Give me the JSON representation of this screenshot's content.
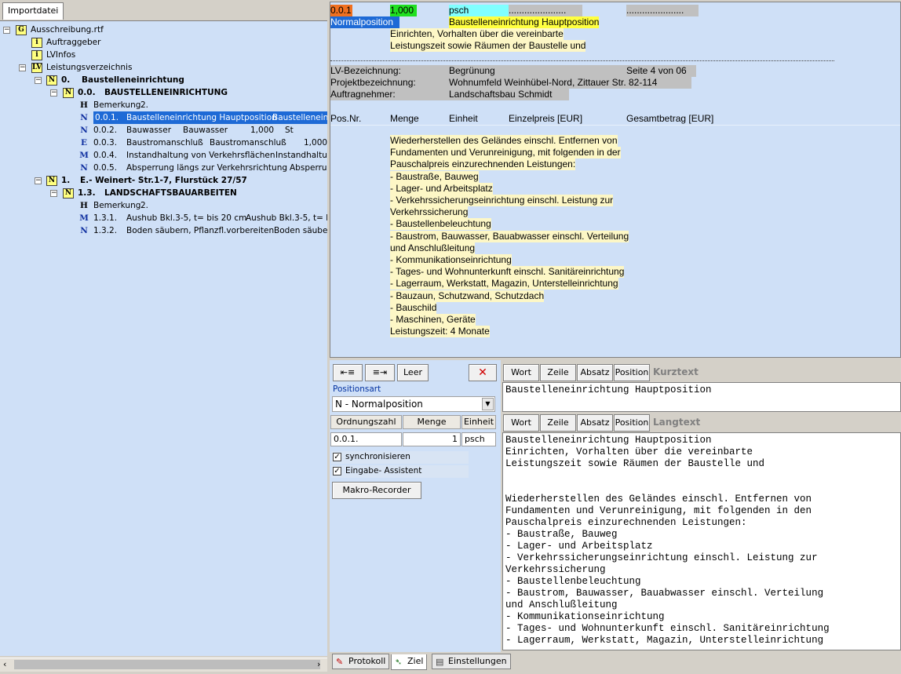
{
  "left_tab": "Importdatei",
  "tree": {
    "root": "Ausschreibung.rtf",
    "auftraggeber": "Auftraggeber",
    "lvinfos": "LVInfos",
    "leistungsverzeichnis": "Leistungsverzeichnis",
    "items": [
      {
        "nr": "0.",
        "text": "Baustelleneinrichtung"
      },
      {
        "nr": "0.0.",
        "text": "BAUSTELLENEINRICHTUNG"
      },
      {
        "nr": "Bemerkung",
        "text": "2."
      },
      {
        "nr": "0.0.1.",
        "text": "Baustelleneinrichtung Hauptposition",
        "extra": "Baustelleneinr"
      },
      {
        "nr": "0.0.2.",
        "text": "Bauwasser",
        "c2": "Bauwasser",
        "c3": "1,000",
        "c4": "St"
      },
      {
        "nr": "0.0.3.",
        "text": "Baustromanschluß",
        "c2": "Baustromanschluß",
        "c3": "1,000"
      },
      {
        "nr": "0.0.4.",
        "text": "Instandhaltung von Verkehrsflächen",
        "c2": "Instandhaltun"
      },
      {
        "nr": "0.0.5.",
        "text": "Absperrung längs zur Verkehrsrichtung",
        "c2": "Absperru"
      },
      {
        "nr": "1.",
        "text": "E.- Weinert- Str.1-7, Flurstück 27/57"
      },
      {
        "nr": "1.3.",
        "text": "LANDSCHAFTSBAUARBEITEN"
      },
      {
        "nr": "Bemerkung",
        "text": "2."
      },
      {
        "nr": "1.3.1.",
        "text": "Aushub Bkl.3-5, t= bis 20 cm",
        "c2": "Aushub Bkl.3-5, t= b"
      },
      {
        "nr": "1.3.2.",
        "text": "Boden säubern, Pflanzfl.vorbereiten",
        "c2": "Boden säube"
      }
    ]
  },
  "preview": {
    "ordnungszahl": "0.0.1",
    "menge": "1,000",
    "einheit": "psch",
    "dots1": "......................",
    "dots2": "......................",
    "positionsart": "Normalposition",
    "kurztext": "Baustelleneinrichtung Hauptposition",
    "line2": "Einrichten, Vorhalten über die vereinbarte",
    "line3": "Leistungszeit sowie Räumen der Baustelle und",
    "lv_label": "LV-Bezeichnung:",
    "lv_value": "Begrünung",
    "seite": "Seite 4 von 06",
    "projekt_label": "Projektbezeichnung:",
    "projekt_value": "Wohnumfeld Weinhübel-Nord, Zittauer Str. 82-114",
    "auftrag_label": "Auftragnehmer:",
    "auftrag_value": "Landschaftsbau Schmidt",
    "col_posnr": "Pos.Nr.",
    "col_menge": "Menge",
    "col_einheit": "Einheit",
    "col_ep": "Einzelpreis [EUR]",
    "col_gb": "Gesamtbetrag [EUR]",
    "body": [
      "Wiederherstellen des Geländes einschl. Entfernen von",
      "Fundamenten und Verunreinigung, mit folgenden in der",
      "Pauschalpreis einzurechnenden Leistungen:",
      "- Baustraße, Bauweg",
      "- Lager- und Arbeitsplatz",
      "- Verkehrssicherungseinrichtung einschl. Leistung zur",
      "Verkehrssicherung",
      "- Baustellenbeleuchtung",
      "- Baustrom, Bauwasser, Bauabwasser einschl. Verteilung",
      "und Anschlußleitung",
      "- Kommunikationseinrichtung",
      "- Tages- und Wohnunterkunft einschl. Sanitäreinrichtung",
      "- Lagerraum, Werkstatt, Magazin, Unterstelleinrichtung",
      "- Bauzaun, Schutzwand, Schutzdach",
      "- Bauschild",
      "- Maschinen, Geräte",
      "Leistungszeit: 4 Monate"
    ]
  },
  "controls": {
    "leer": "Leer",
    "positionsart_label": "Positionsart",
    "positionsart_value": "N - Normalposition",
    "h_ordnungszahl": "Ordnungszahl",
    "h_menge": "Menge",
    "h_einheit": "Einheit",
    "v_ordnungszahl": "0.0.1.",
    "v_menge": "1",
    "v_einheit": "psch",
    "sync": "synchronisieren",
    "assistent": "Eingabe- Assistent",
    "makro": "Makro-Recorder"
  },
  "editor": {
    "wort": "Wort",
    "zeile": "Zeile",
    "absatz": "Absatz",
    "position": "Position",
    "kurztext_title": "Kurztext",
    "langtext_title": "Langtext",
    "kurztext": "Baustelleneinrichtung Hauptposition",
    "langtext": "Baustelleneinrichtung Hauptposition\nEinrichten, Vorhalten über die vereinbarte\nLeistungszeit sowie Räumen der Baustelle und\n\n\nWiederherstellen des Geländes einschl. Entfernen von\nFundamenten und Verunreinigung, mit folgenden in den\nPauschalpreis einzurechnenden Leistungen:\n- Baustraße, Bauweg\n- Lager- und Arbeitsplatz\n- Verkehrssicherungseinrichtung einschl. Leistung zur\nVerkehrssicherung\n- Baustellenbeleuchtung\n- Baustrom, Bauwasser, Bauabwasser einschl. Verteilung\nund Anschlußleitung\n- Kommunikationseinrichtung\n- Tages- und Wohnunterkunft einschl. Sanitäreinrichtung\n- Lagerraum, Werkstatt, Magazin, Unterstelleinrichtung"
  },
  "bottom_tabs": [
    "Protokoll",
    "Ziel",
    "Einstellungen"
  ],
  "colors": {
    "accent": "#1e6ad6",
    "tree_bg": "#cfe0f7",
    "highlight": "#fdf7c6"
  }
}
